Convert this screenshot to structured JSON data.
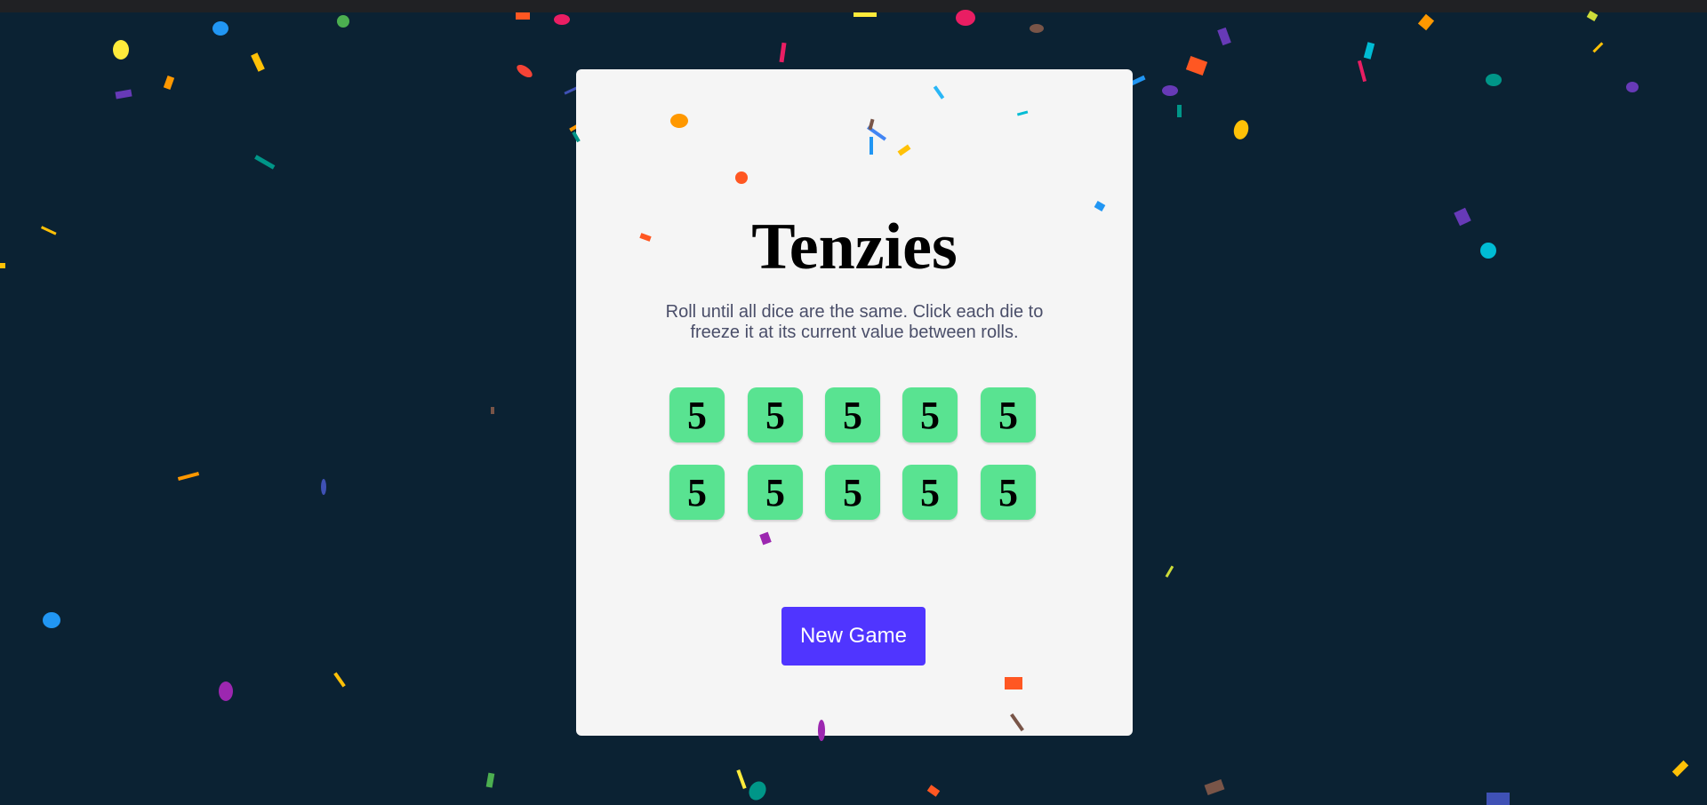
{
  "app": {
    "title": "Tenzies",
    "instructions": "Roll until all dice are the same. Click each die to freeze it at its current value between rolls."
  },
  "dice": [
    {
      "value": "5",
      "held": false
    },
    {
      "value": "5",
      "held": false
    },
    {
      "value": "5",
      "held": false
    },
    {
      "value": "5",
      "held": false
    },
    {
      "value": "5",
      "held": false
    },
    {
      "value": "5",
      "held": false
    },
    {
      "value": "5",
      "held": false
    },
    {
      "value": "5",
      "held": false
    },
    {
      "value": "5",
      "held": false
    },
    {
      "value": "5",
      "held": false
    }
  ],
  "controls": {
    "new_game_label": "New Game"
  },
  "colors": {
    "background": "#0b2233",
    "card": "#f5f5f5",
    "die": "#59e391",
    "button": "#5035ff",
    "instructions": "#4a4e69"
  },
  "state": {
    "won": true,
    "confetti": "active"
  }
}
